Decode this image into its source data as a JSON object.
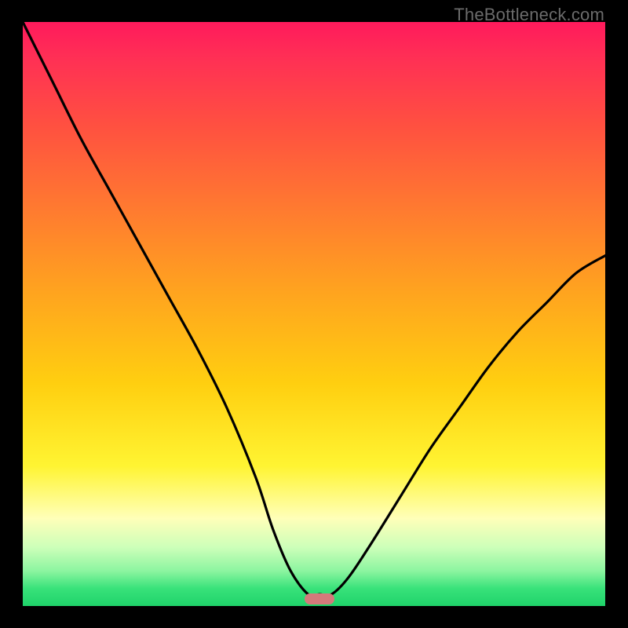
{
  "watermark": "TheBottleneck.com",
  "colors": {
    "frame_bg": "#000000",
    "curve_stroke": "#000000",
    "marker_fill": "#d47a7b"
  },
  "chart_data": {
    "type": "line",
    "title": "",
    "xlabel": "",
    "ylabel": "",
    "xlim": [
      0,
      1
    ],
    "ylim": [
      0,
      1
    ],
    "grid": false,
    "legend": false,
    "series": [
      {
        "name": "bottleneck-curve",
        "x": [
          0.0,
          0.05,
          0.1,
          0.15,
          0.2,
          0.25,
          0.3,
          0.35,
          0.4,
          0.43,
          0.46,
          0.49,
          0.51,
          0.53,
          0.56,
          0.6,
          0.65,
          0.7,
          0.75,
          0.8,
          0.85,
          0.9,
          0.95,
          1.0
        ],
        "y": [
          1.0,
          0.9,
          0.8,
          0.71,
          0.62,
          0.53,
          0.44,
          0.34,
          0.22,
          0.13,
          0.06,
          0.02,
          0.02,
          0.02,
          0.05,
          0.11,
          0.19,
          0.27,
          0.34,
          0.41,
          0.47,
          0.52,
          0.57,
          0.6
        ]
      }
    ],
    "marker": {
      "x": 0.51,
      "y": 0.01,
      "shape": "rounded-pill"
    }
  }
}
